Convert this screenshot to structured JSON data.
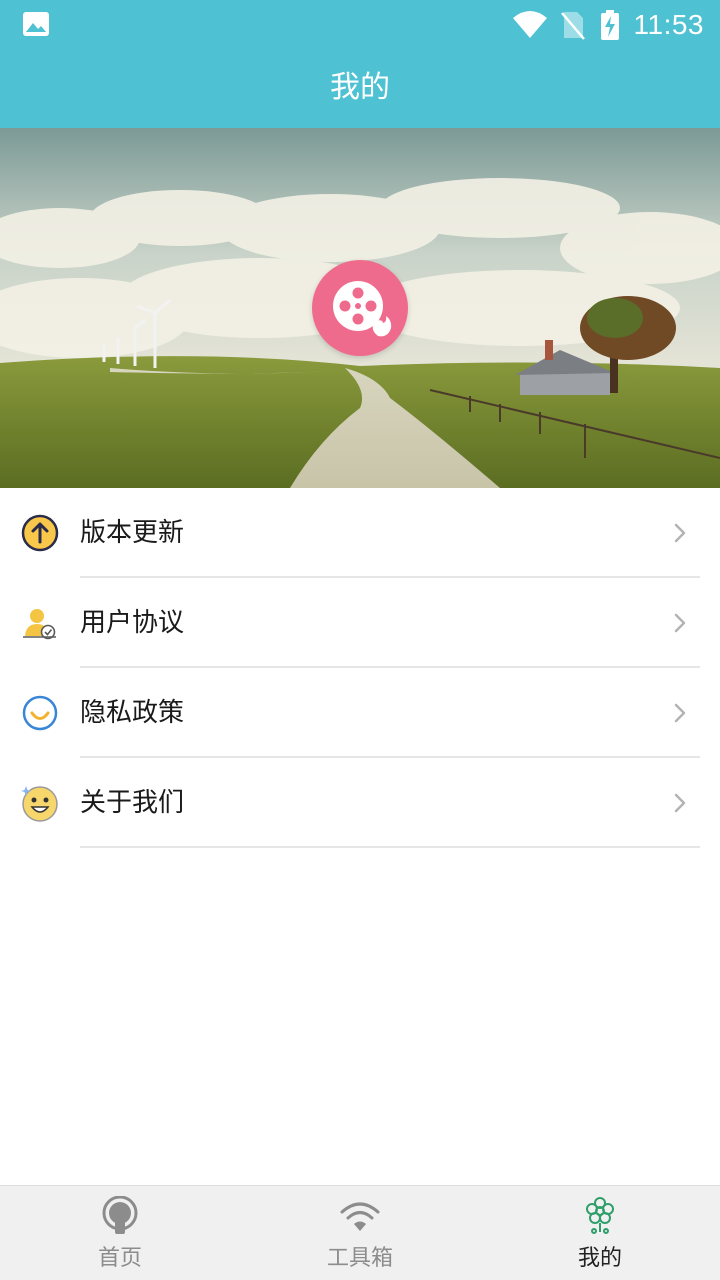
{
  "status_bar": {
    "time": "11:53",
    "icons": [
      "gallery-icon",
      "wifi-icon",
      "no-sim-icon",
      "battery-charging-icon"
    ]
  },
  "app_bar": {
    "title": "我的"
  },
  "hero": {
    "logo_icon": "film-reel-icon",
    "logo_color": "#ef6b8e"
  },
  "menu": {
    "items": [
      {
        "label": "版本更新",
        "icon": "version-update-icon"
      },
      {
        "label": "用户协议",
        "icon": "user-agreement-icon"
      },
      {
        "label": "隐私政策",
        "icon": "privacy-policy-icon"
      },
      {
        "label": "关于我们",
        "icon": "about-us-icon"
      }
    ],
    "arrow_icon": "chevron-right-icon"
  },
  "bottom_nav": {
    "items": [
      {
        "label": "首页",
        "icon": "home-icon",
        "active": false
      },
      {
        "label": "工具箱",
        "icon": "toolbox-wifi-icon",
        "active": false
      },
      {
        "label": "我的",
        "icon": "mine-flower-icon",
        "active": true
      }
    ]
  },
  "colors": {
    "accent": "#4ec1d3",
    "logo": "#ef6b8e",
    "active_nav": "#2e9e6a",
    "inactive_nav": "#8c8c8c"
  }
}
